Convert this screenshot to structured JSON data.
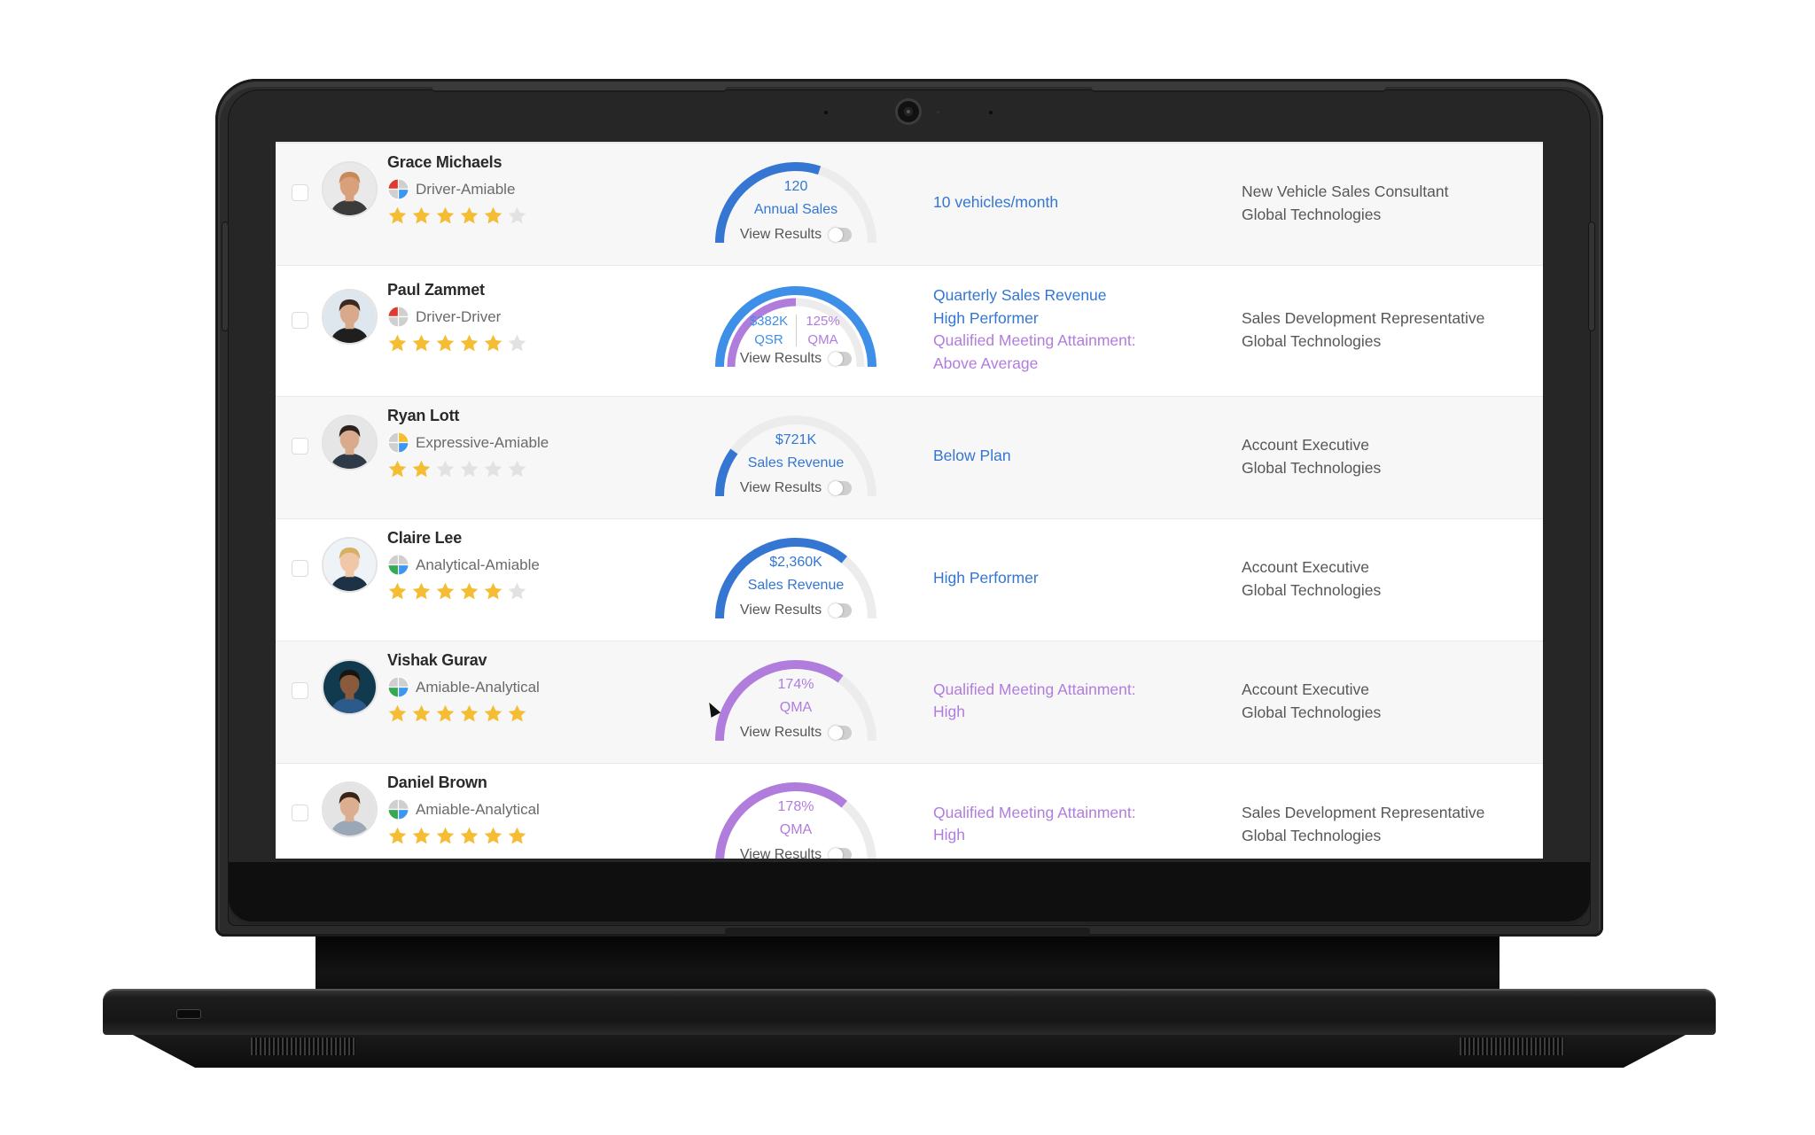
{
  "colors": {
    "blue": "#3476d2",
    "blue_light": "#3d8fe8",
    "purple": "#b07ddd",
    "track": "#ececec",
    "star_on": "#f4bd34",
    "star_off": "#e2e2e2",
    "persona_driver": "#e03a32",
    "persona_expressive": "#f4bd34",
    "persona_amiable": "#3d97ee",
    "persona_analytical": "#36a852",
    "persona_empty": "#cfcfcf"
  },
  "view_results_label": "View Results",
  "people": [
    {
      "name": "Grace Michaels",
      "persona": "Driver-Amiable",
      "persona_quadrants": [
        "driver",
        "amiable"
      ],
      "rating": 5,
      "rating_max": 6,
      "gauge": {
        "type": "single",
        "value": "120",
        "label": "Annual Sales",
        "color": "blue",
        "fill": 0.6
      },
      "status_lines": [
        {
          "text": "10 vehicles/month",
          "color": "blue"
        }
      ],
      "role": "New Vehicle Sales Consultant",
      "company": "Global Technologies",
      "view_results_on": false
    },
    {
      "name": "Paul Zammet",
      "persona": "Driver-Driver",
      "persona_quadrants": [
        "driver"
      ],
      "rating": 5,
      "rating_max": 6,
      "gauge": {
        "type": "dual",
        "left": {
          "value": "$382K",
          "label": "QSR",
          "color": "blue_light",
          "fill": 1.0
        },
        "right": {
          "value": "125%",
          "label": "QMA",
          "color": "purple",
          "fill": 0.5
        }
      },
      "status_lines": [
        {
          "text": "Quarterly Sales Revenue",
          "color": "blue"
        },
        {
          "text": "High Performer",
          "color": "blue"
        },
        {
          "text": "Qualified Meeting Attainment:",
          "color": "purple"
        },
        {
          "text": "Above Average",
          "color": "purple"
        }
      ],
      "role": "Sales Development Representative",
      "company": "Global Technologies",
      "view_results_on": false
    },
    {
      "name": "Ryan Lott",
      "persona": "Expressive-Amiable",
      "persona_quadrants": [
        "expressive",
        "amiable"
      ],
      "rating": 2,
      "rating_max": 6,
      "gauge": {
        "type": "single",
        "value": "$721K",
        "label": "Sales Revenue",
        "color": "blue",
        "fill": 0.2
      },
      "status_lines": [
        {
          "text": "Below Plan",
          "color": "blue"
        }
      ],
      "role": "Account Executive",
      "company": "Global Technologies",
      "view_results_on": false
    },
    {
      "name": "Claire Lee",
      "persona": "Analytical-Amiable",
      "persona_quadrants": [
        "analytical",
        "amiable"
      ],
      "rating": 5,
      "rating_max": 6,
      "gauge": {
        "type": "single",
        "value": "$2,360K",
        "label": "Sales Revenue",
        "color": "blue",
        "fill": 0.72
      },
      "status_lines": [
        {
          "text": "High Performer",
          "color": "blue"
        }
      ],
      "role": "Account Executive",
      "company": "Global Technologies",
      "view_results_on": false
    },
    {
      "name": "Vishak Gurav",
      "persona": "Amiable-Analytical",
      "persona_quadrants": [
        "analytical",
        "amiable"
      ],
      "rating": 6,
      "rating_max": 6,
      "gauge": {
        "type": "single",
        "value": "174%",
        "label": "QMA",
        "color": "purple",
        "fill": 0.7
      },
      "status_lines": [
        {
          "text": "Qualified Meeting Attainment:",
          "color": "purple"
        },
        {
          "text": "High",
          "color": "purple"
        }
      ],
      "role": "Account Executive",
      "company": "Global Technologies",
      "view_results_on": false
    },
    {
      "name": "Daniel Brown",
      "persona": "Amiable-Analytical",
      "persona_quadrants": [
        "analytical",
        "amiable"
      ],
      "rating": 6,
      "rating_max": 6,
      "gauge": {
        "type": "single",
        "value": "178%",
        "label": "QMA",
        "color": "purple",
        "fill": 0.72
      },
      "status_lines": [
        {
          "text": "Qualified Meeting Attainment:",
          "color": "purple"
        },
        {
          "text": "High",
          "color": "purple"
        }
      ],
      "role": "Sales Development Representative",
      "company": "Global Technologies",
      "view_results_on": false
    }
  ]
}
